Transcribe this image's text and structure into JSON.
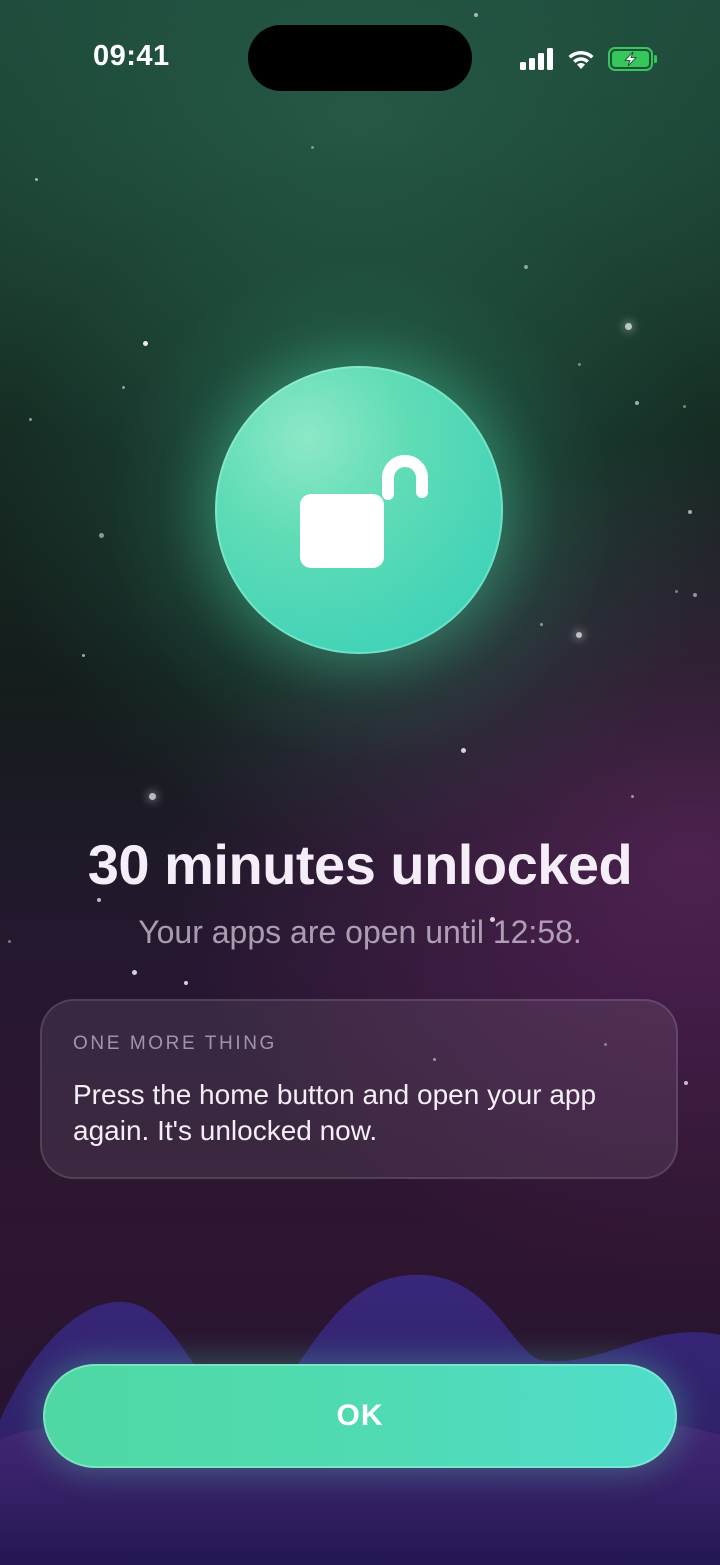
{
  "status_bar": {
    "time": "09:41",
    "icons": [
      "signal-icon",
      "wifi-icon",
      "battery-charging-icon"
    ]
  },
  "hero": {
    "icon": "unlocked-padlock-icon",
    "title": "30 minutes unlocked",
    "subtitle": "Your apps are open until 12:58."
  },
  "info_card": {
    "eyebrow": "ONE MORE THING",
    "body": "Press the home button and open your app again. It's unlocked now."
  },
  "actions": {
    "ok_label": "OK"
  },
  "colors": {
    "accent": "#4fd8b0",
    "battery": "#34c759"
  }
}
